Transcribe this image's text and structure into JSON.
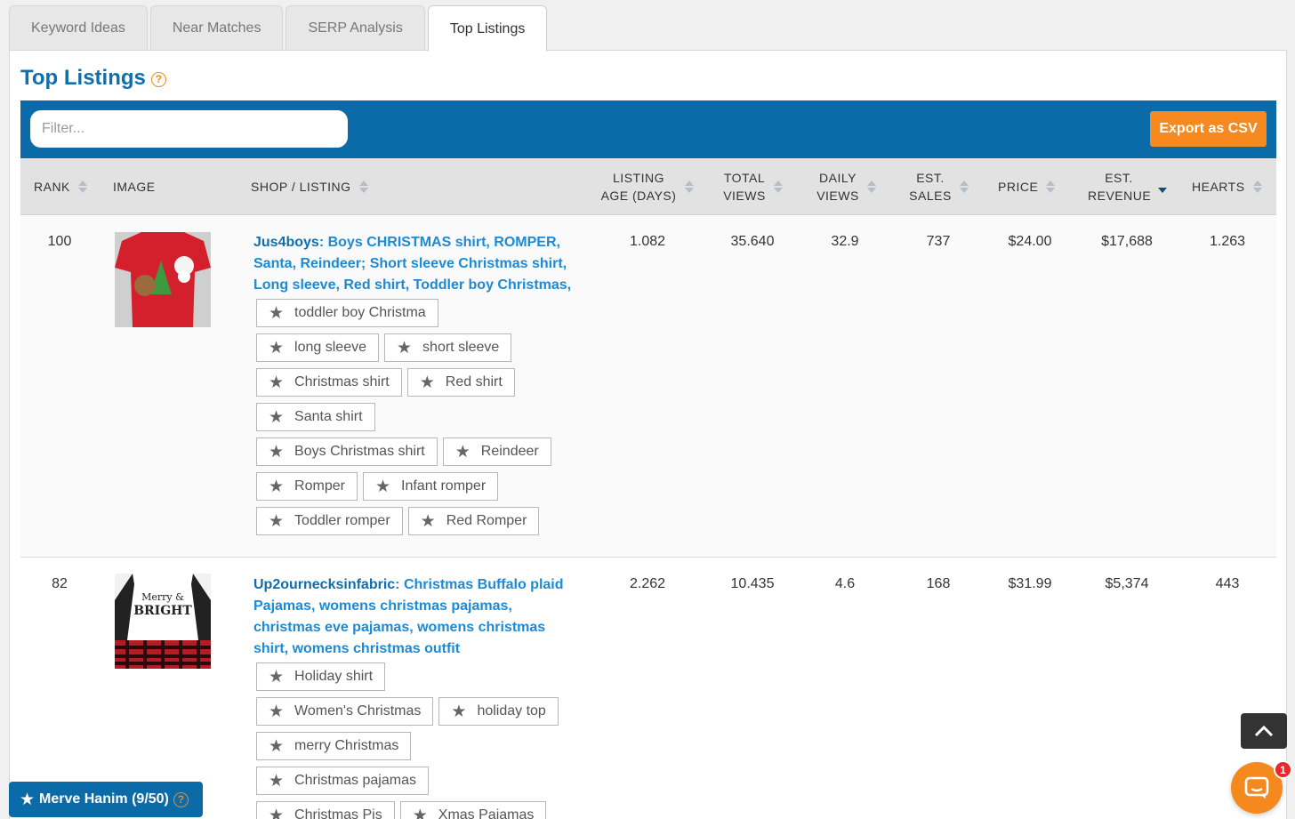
{
  "tabs": [
    {
      "label": "Keyword Ideas"
    },
    {
      "label": "Near Matches"
    },
    {
      "label": "SERP Analysis"
    },
    {
      "label": "Top Listings"
    }
  ],
  "active_tab": "Top Listings",
  "page": {
    "title": "Top Listings",
    "help": "?"
  },
  "toolbar": {
    "filter_placeholder": "Filter...",
    "export_label": "Export as CSV"
  },
  "columns": [
    {
      "label": "RANK"
    },
    {
      "label": "IMAGE"
    },
    {
      "label": "SHOP / LISTING"
    },
    {
      "label": "LISTING AGE (DAYS)"
    },
    {
      "label": "TOTAL VIEWS"
    },
    {
      "label": "DAILY VIEWS"
    },
    {
      "label": "EST. SALES"
    },
    {
      "label": "PRICE"
    },
    {
      "label": "EST. REVENUE"
    },
    {
      "label": "HEARTS"
    }
  ],
  "sorted_column": "EST. REVENUE",
  "sort_direction": "descending",
  "rows": [
    {
      "rank": "100",
      "shop": "Jus4boys",
      "sep": ":",
      "listing": "Boys CHRISTMAS shirt, ROMPER, Santa, Reindeer; Short sleeve Christmas shirt, Long sleeve, Red shirt, Toddler boy Christmas,",
      "age": "1.082",
      "total_views": "35.640",
      "daily_views": "32.9",
      "sales": "737",
      "price": "$24.00",
      "revenue": "$17,688",
      "hearts": "1.263",
      "tags": [
        "toddler boy Christma",
        "long sleeve",
        "short sleeve",
        "Christmas shirt",
        "Red shirt",
        "Santa shirt",
        "Boys Christmas shirt",
        "Reindeer",
        "Romper",
        "Infant romper",
        "Toddler romper",
        "Red Romper"
      ]
    },
    {
      "rank": "82",
      "shop": "Up2ournecksinfabric",
      "sep": ":",
      "listing": "Christmas Buffalo plaid Pajamas, womens christmas pajamas, christmas eve pajamas, womens christmas shirt, womens christmas outfit",
      "age": "2.262",
      "total_views": "10.435",
      "daily_views": "4.6",
      "sales": "168",
      "price": "$31.99",
      "revenue": "$5,374",
      "hearts": "443",
      "tags": [
        "Holiday shirt",
        "Women's Christmas",
        "holiday top",
        "merry Christmas",
        "Christmas pajamas",
        "Christmas Pjs",
        "Xmas Pajamas"
      ],
      "image_text": "Merry & BRIGHT"
    }
  ],
  "user": {
    "label": "Merve Hanim (9/50)"
  },
  "chat": {
    "badge": "1"
  },
  "colors": {
    "brand_blue": "#0b6aa8",
    "accent_orange": "#f6891f",
    "link_blue": "#1c8ad6"
  }
}
